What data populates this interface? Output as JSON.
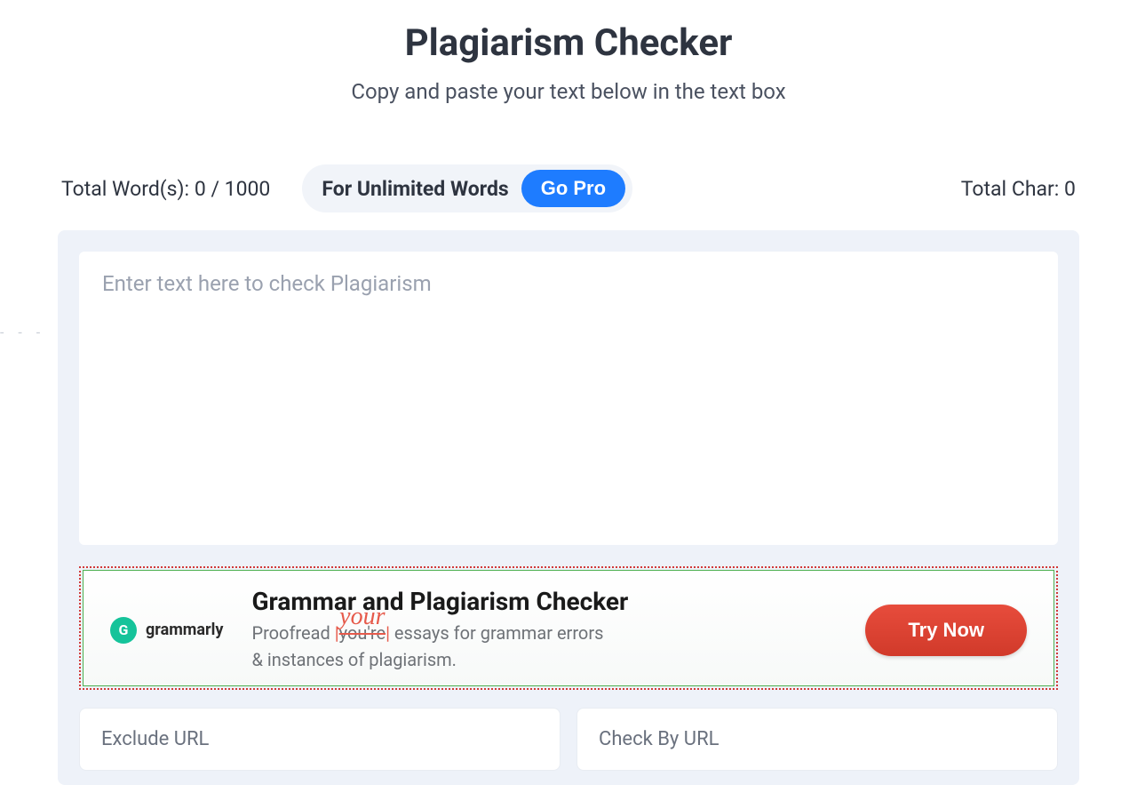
{
  "header": {
    "title": "Plagiarism Checker",
    "subtitle": "Copy and paste your text below in the text box"
  },
  "stats": {
    "word_label": "Total Word(s): 0 / 1000",
    "char_label": "Total Char: 0"
  },
  "unlimited": {
    "text": "For Unlimited Words",
    "cta": "Go Pro"
  },
  "editor": {
    "placeholder": "Enter text here to check Plagiarism"
  },
  "ad": {
    "brand": "grammarly",
    "logo_letter": "G",
    "heading": "Grammar and Plagiarism Checker",
    "line_prefix": "Proofread ",
    "strike": "you're",
    "correction": "your",
    "line_suffix": " essays for grammar errors",
    "line2": "& instances of plagiarism.",
    "cta": "Try Now"
  },
  "inputs": {
    "exclude_placeholder": "Exclude URL",
    "checkby_placeholder": "Check By URL"
  },
  "colors": {
    "accent": "#1e7cff",
    "danger": "#e74c3c",
    "brand_green": "#15c39a"
  }
}
